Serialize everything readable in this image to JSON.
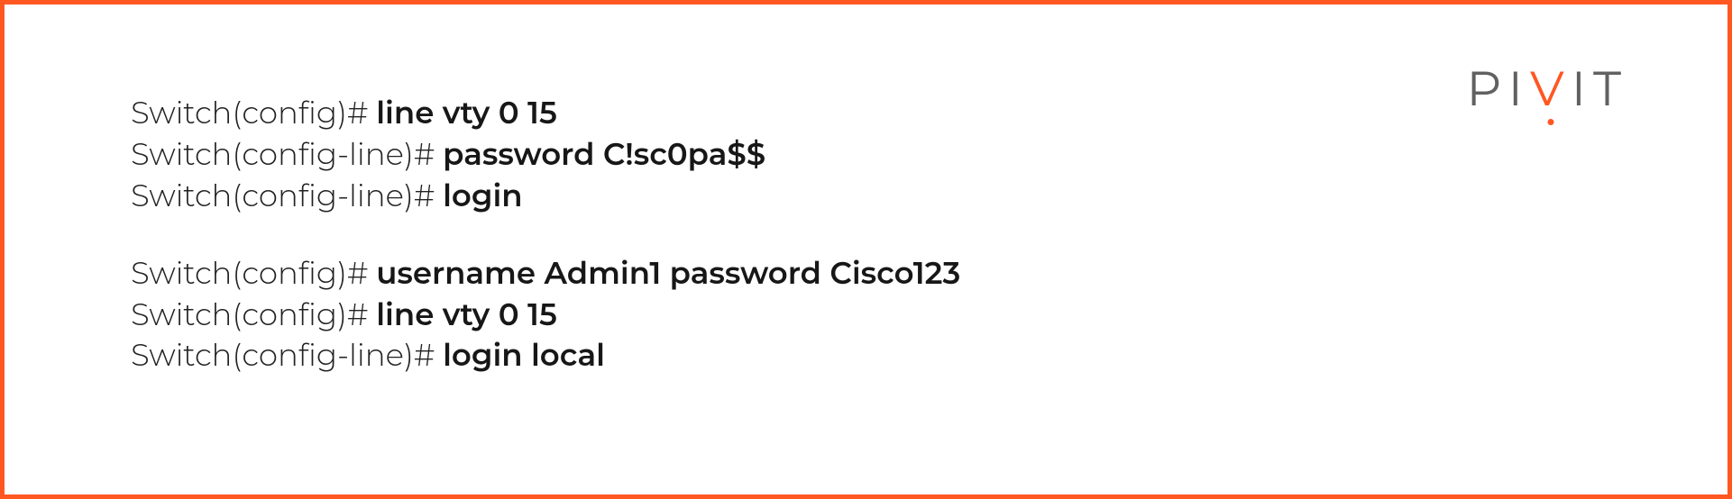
{
  "brand": {
    "p1": "PI",
    "v": "V",
    "p2": "IT"
  },
  "lines": [
    {
      "prompt": "Switch(config)# ",
      "cmd": "line vty 0 15"
    },
    {
      "prompt": "Switch(config-line)# ",
      "cmd": "password C!sc0pa$$"
    },
    {
      "prompt": "Switch(config-line)# ",
      "cmd": "login"
    }
  ],
  "lines2": [
    {
      "prompt": "Switch(config)# ",
      "cmd": "username Admin1 password Cisco123"
    },
    {
      "prompt": "Switch(config)# ",
      "cmd": "line vty 0 15"
    },
    {
      "prompt": "Switch(config-line)# ",
      "cmd": "login local"
    }
  ]
}
